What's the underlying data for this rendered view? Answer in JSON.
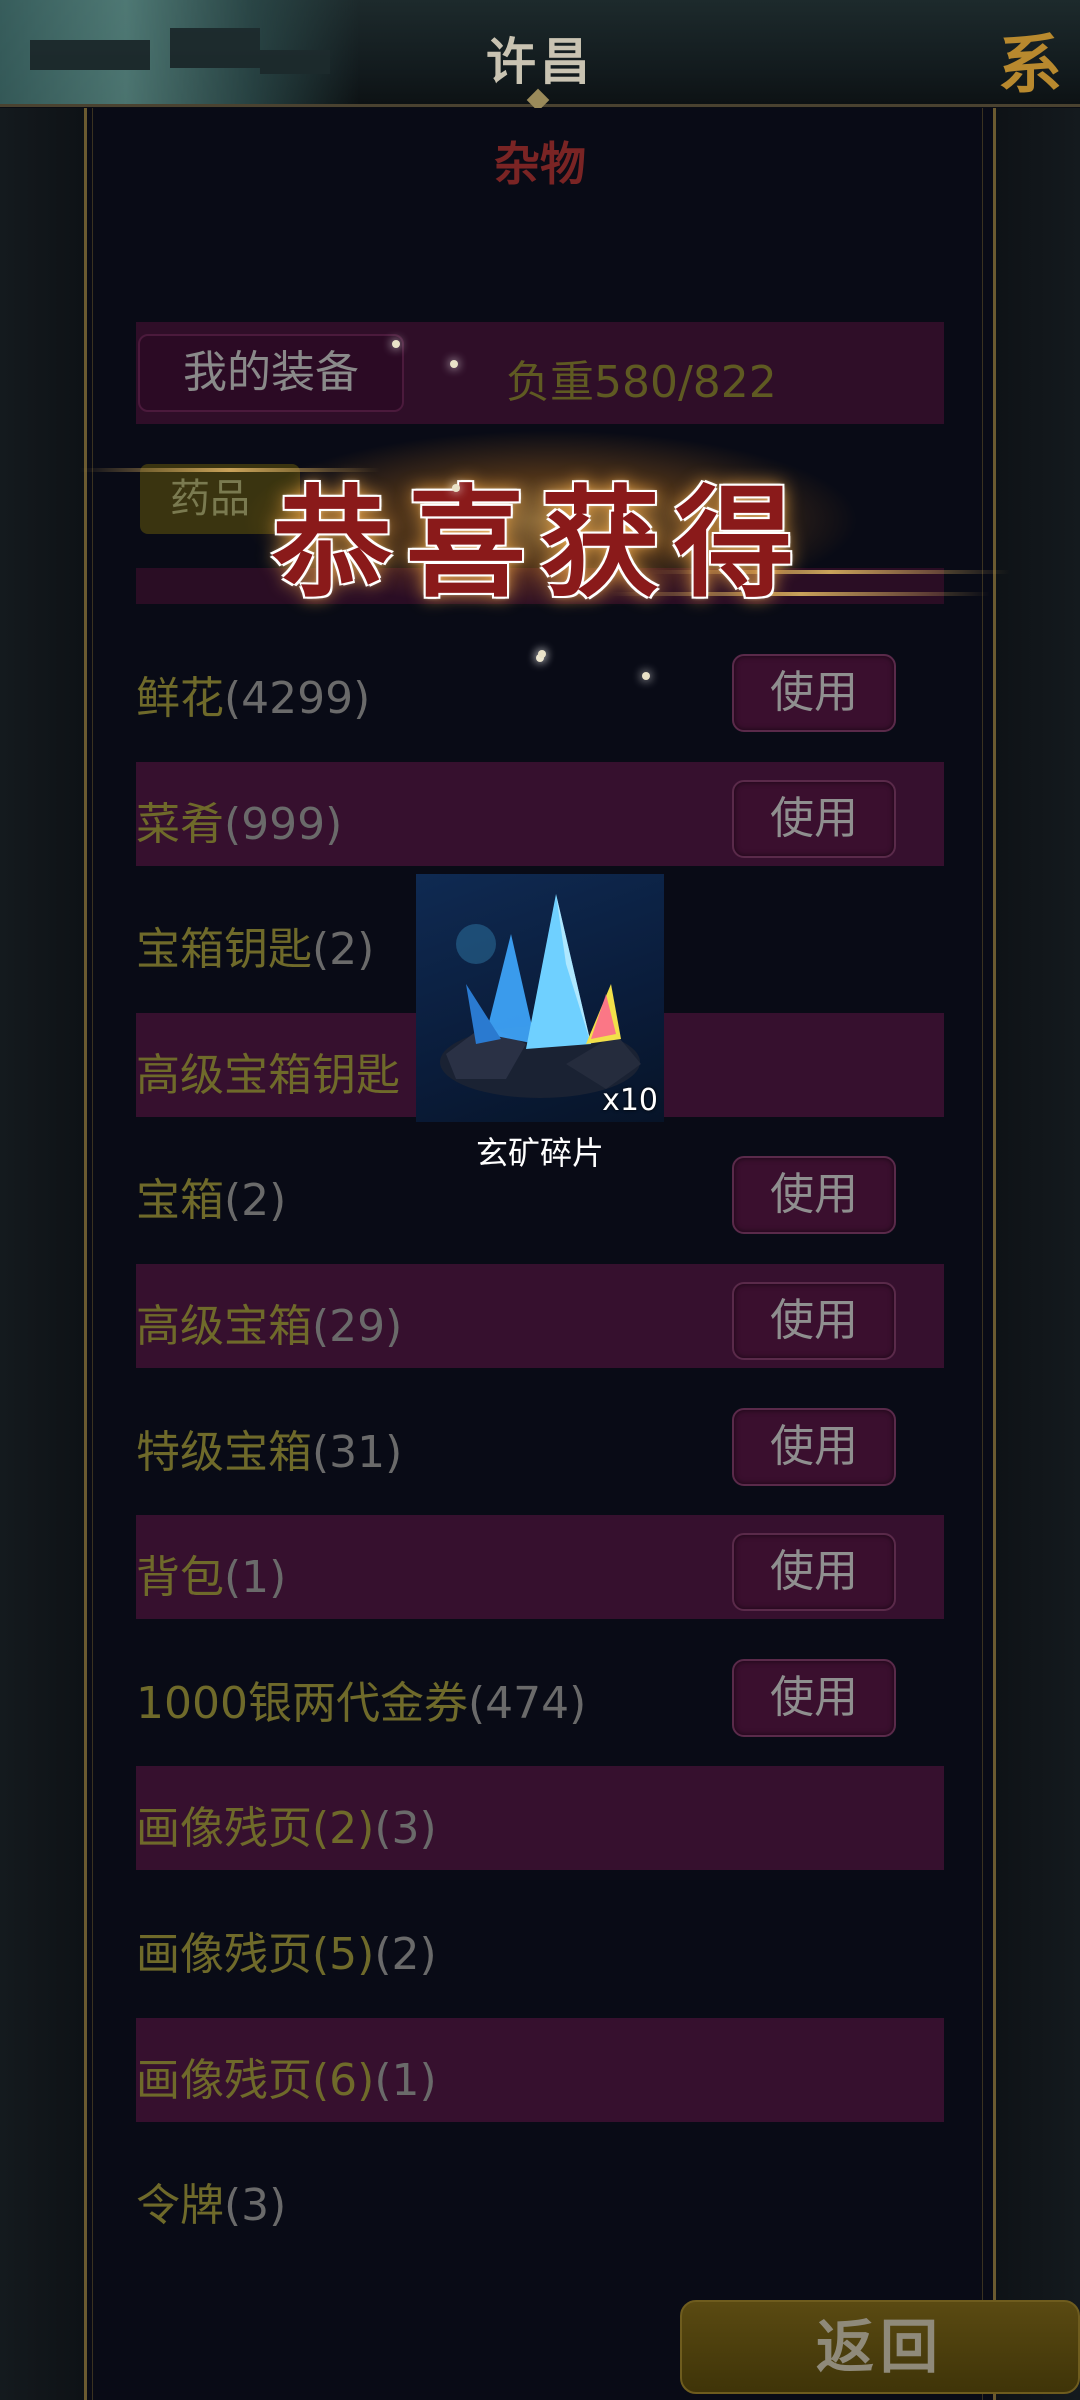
{
  "header": {
    "title": "许昌",
    "corner_glyph": "系"
  },
  "panel": {
    "subtitle": "杂物"
  },
  "tabs": {
    "equipment": "我的装备",
    "weight": "负重580/822",
    "medicine": "药品"
  },
  "overlay": {
    "congrats_text": "恭喜获得",
    "reward_name": "玄矿碎片",
    "reward_qty": "x10",
    "reward_icon": "crystal-icon"
  },
  "items": [
    {
      "name": "鲜花",
      "count": "(4299)",
      "use": "使用"
    },
    {
      "name": "菜肴",
      "count": "(999)",
      "use": "使用"
    },
    {
      "name": "宝箱钥匙",
      "count": "(2)",
      "use": ""
    },
    {
      "name": "高级宝箱钥匙",
      "count": "",
      "use": ""
    },
    {
      "name": "宝箱",
      "count": "(2)",
      "use": "使用"
    },
    {
      "name": "高级宝箱",
      "count": "(29)",
      "use": "使用"
    },
    {
      "name": "特级宝箱",
      "count": "(31)",
      "use": "使用"
    },
    {
      "name": "背包",
      "count": "(1)",
      "use": "使用"
    },
    {
      "name": "1000银两代金券",
      "count": "(474)",
      "use": "使用"
    },
    {
      "name": "画像残页(2)",
      "count": "(3)",
      "use": ""
    },
    {
      "name": "画像残页(5)",
      "count": "(2)",
      "use": ""
    },
    {
      "name": "画像残页(6)",
      "count": "(1)",
      "use": ""
    },
    {
      "name": "令牌",
      "count": "(3)",
      "use": ""
    }
  ],
  "footer": {
    "back_label": "返回"
  }
}
